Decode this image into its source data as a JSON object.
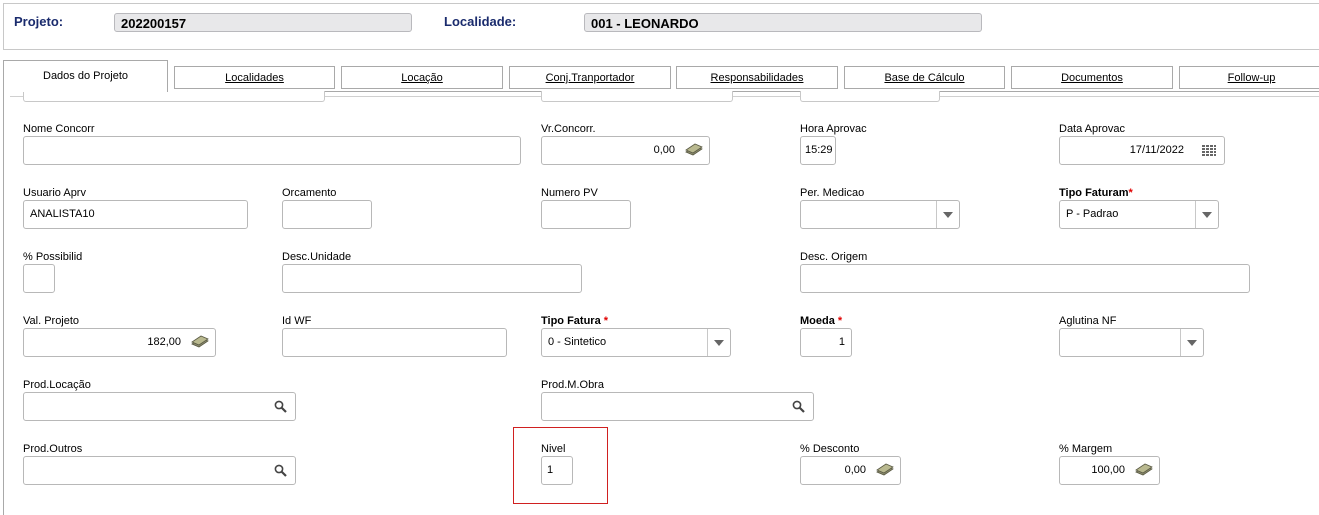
{
  "header": {
    "projeto_label": "Projeto:",
    "projeto_value": "202200157",
    "localidade_label": "Localidade:",
    "localidade_value": "001 - LEONARDO"
  },
  "tabs": [
    {
      "label": "Dados do Projeto",
      "active": true
    },
    {
      "label": "Localidades"
    },
    {
      "label": "Locação"
    },
    {
      "label": "Conj.Tranportador"
    },
    {
      "label": "Responsabilidades"
    },
    {
      "label": "Base de Cálculo"
    },
    {
      "label": "Documentos"
    },
    {
      "label": "Follow-up"
    }
  ],
  "form": {
    "nome_concorr": {
      "label": "Nome Concorr",
      "value": ""
    },
    "vr_concorr": {
      "label": "Vr.Concorr.",
      "value": "0,00"
    },
    "hora_aprovac": {
      "label": "Hora Aprovac",
      "value": "15:29"
    },
    "data_aprovac": {
      "label": "Data Aprovac",
      "value": "17/11/2022"
    },
    "usuario_aprv": {
      "label": "Usuario Aprv",
      "value": "ANALISTA10"
    },
    "orcamento": {
      "label": "Orcamento",
      "value": ""
    },
    "numero_pv": {
      "label": "Numero PV",
      "value": ""
    },
    "per_medicao": {
      "label": "Per. Medicao",
      "value": ""
    },
    "tipo_faturam": {
      "label": "Tipo Faturam",
      "required": "*",
      "value": "P - Padrao"
    },
    "possibilid": {
      "label": "% Possibilid",
      "value": ""
    },
    "desc_unidade": {
      "label": "Desc.Unidade",
      "value": ""
    },
    "desc_origem": {
      "label": "Desc. Origem",
      "value": ""
    },
    "val_projeto": {
      "label": "Val. Projeto",
      "value": "182,00"
    },
    "id_wf": {
      "label": "Id WF",
      "value": ""
    },
    "tipo_fatura": {
      "label": "Tipo Fatura",
      "required": "*",
      "value": "0 - Sintetico"
    },
    "moeda": {
      "label": "Moeda",
      "required": "*",
      "value": "1"
    },
    "aglutina_nf": {
      "label": "Aglutina NF",
      "value": ""
    },
    "prod_locacao": {
      "label": "Prod.Locação",
      "value": ""
    },
    "prod_m_obra": {
      "label": "Prod.M.Obra",
      "value": ""
    },
    "prod_outros": {
      "label": "Prod.Outros",
      "value": ""
    },
    "nivel": {
      "label": "Nivel",
      "value": "1"
    },
    "desconto": {
      "label": "% Desconto",
      "value": "0,00"
    },
    "margem": {
      "label": "% Margem",
      "value": "100,00"
    }
  },
  "icons": {
    "money": "money-icon",
    "calendar": "calendar-icon",
    "search": "search-icon",
    "dropdown": "chevron-down-icon"
  },
  "colors": {
    "header_label": "#1a2b6d",
    "required": "#e00000",
    "highlight": "#d02020"
  }
}
